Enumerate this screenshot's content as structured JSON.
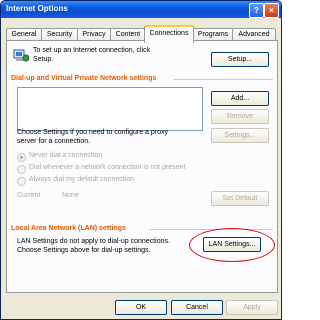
{
  "window": {
    "title": "Internet Options",
    "help_label": "?",
    "close_label": "×"
  },
  "tabs": [
    "General",
    "Security",
    "Privacy",
    "Content",
    "Connections",
    "Programs",
    "Advanced"
  ],
  "setup": {
    "text_line1": "To set up an Internet connection, click",
    "text_line2": "Setup.",
    "button": "Setup..."
  },
  "dialup": {
    "title": "Dial-up and Virtual Private Network settings",
    "add": "Add...",
    "remove": "Remove",
    "settings": "Settings...",
    "help_line1": "Choose Settings if you need to configure a proxy",
    "help_line2": "server for a connection.",
    "options": [
      "Never dial a connection",
      "Dial whenever a network connection is not present",
      "Always dial my default connection"
    ],
    "current_label": "Current",
    "current_value": "None",
    "set_default": "Set Default"
  },
  "lan": {
    "title": "Local Area Network (LAN) settings",
    "line1": "LAN Settings do not apply to dial-up connections.",
    "line2": "Choose Settings above for dial-up settings.",
    "button": "LAN Settings..."
  },
  "footer": {
    "ok": "OK",
    "cancel": "Cancel",
    "apply": "Apply"
  }
}
